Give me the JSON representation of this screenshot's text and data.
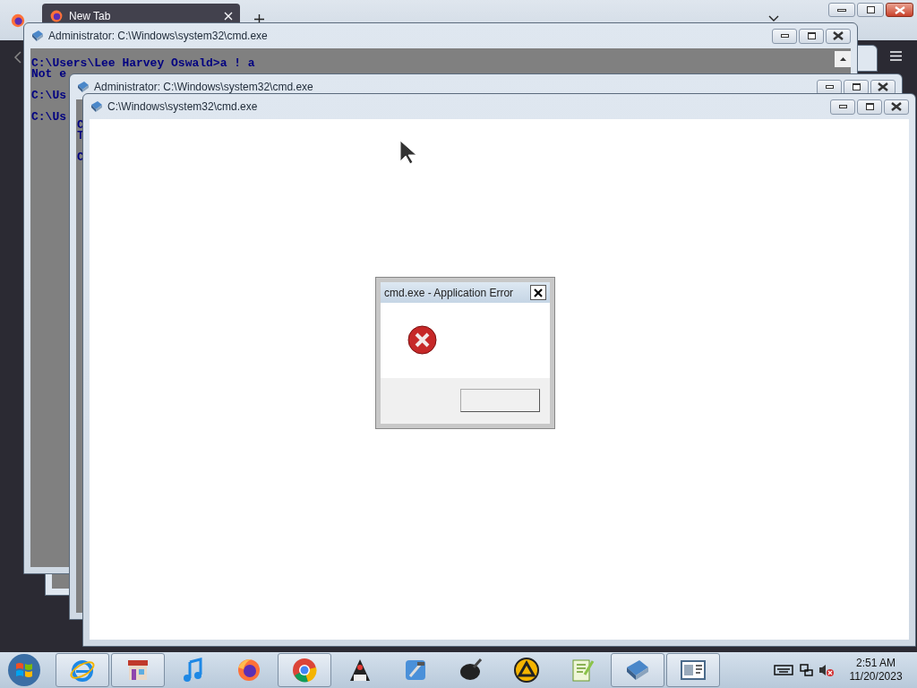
{
  "browser": {
    "tab_title": "New Tab"
  },
  "windows": [
    {
      "title": "Administrator: C:\\Windows\\system32\\cmd.exe",
      "console_blocks": [
        [
          "C:\\Users\\Lee Harvey Oswald>a ! a",
          "Not e"
        ],
        [
          "C:\\Us"
        ],
        [
          "C:\\Us"
        ]
      ]
    },
    {
      "title": "Administrator: C:\\Windows\\system32\\cmd.exe",
      "console_blocks": [
        [
          "C",
          "T"
        ],
        [
          "C"
        ]
      ]
    },
    {
      "title": "C:\\Windows\\system32\\cmd.exe"
    }
  ],
  "dialog": {
    "title": "cmd.exe - Application Error"
  },
  "taskbar": {
    "apps": [
      {
        "running": true
      },
      {
        "running": true
      },
      {
        "running": false
      },
      {
        "running": false
      },
      {
        "running": true
      },
      {
        "running": false
      },
      {
        "running": false
      },
      {
        "running": false
      },
      {
        "running": false
      },
      {
        "running": false
      },
      {
        "running": true
      },
      {
        "running": true
      }
    ],
    "time": "2:51 AM",
    "date": "11/20/2023"
  }
}
